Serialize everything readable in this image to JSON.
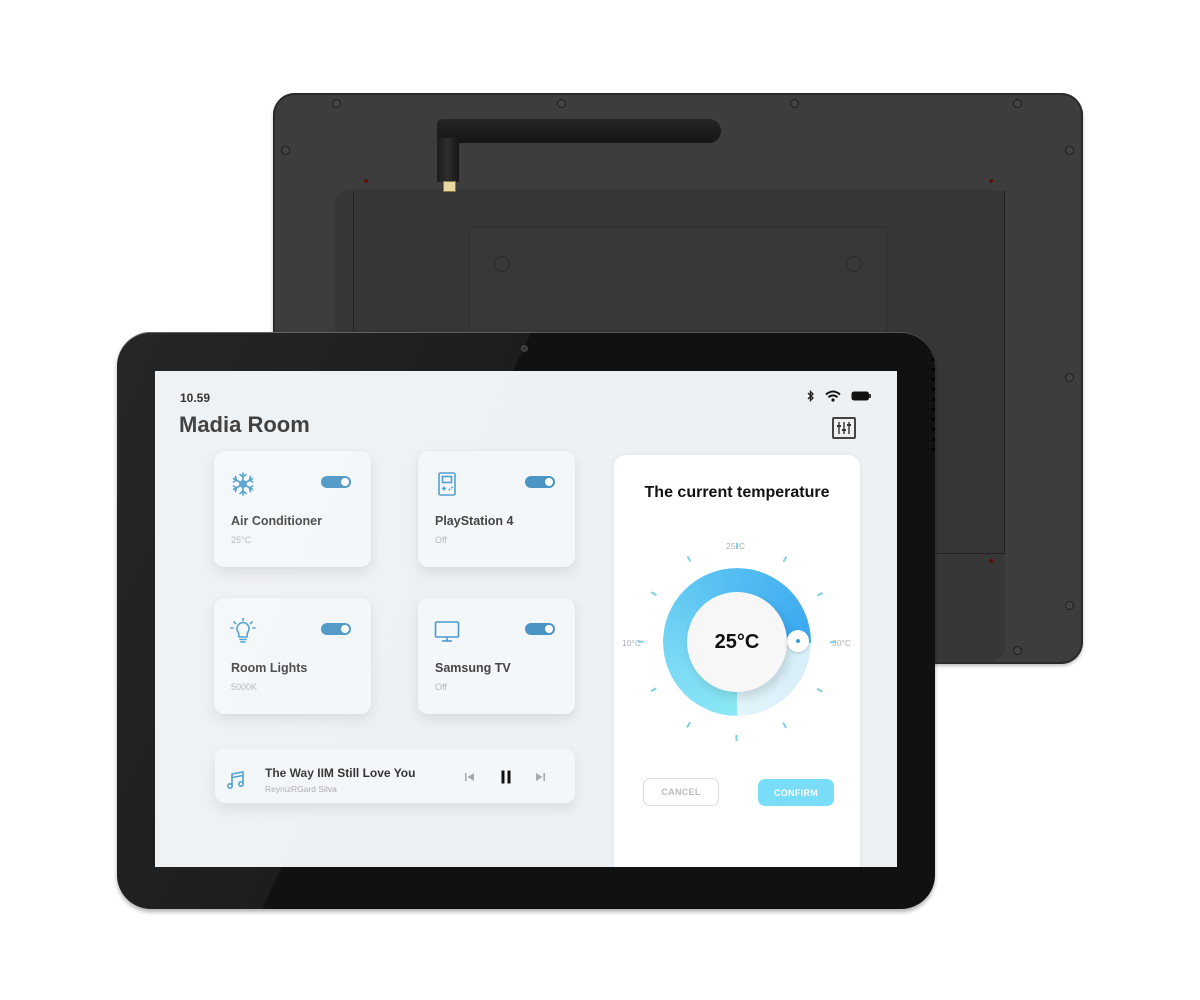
{
  "status_bar": {
    "time": "10.59",
    "icons": [
      "bluetooth-icon",
      "wifi-icon",
      "battery-icon"
    ]
  },
  "header": {
    "room_title": "Madia Room",
    "settings_icon": "equalizer-sliders-icon"
  },
  "devices": [
    {
      "name": "Air Conditioner",
      "status": "25°C",
      "icon": "snowflake-icon",
      "on": true
    },
    {
      "name": "PlayStation 4",
      "status": "Off",
      "icon": "gameboy-icon",
      "on": true
    },
    {
      "name": "Room Lights",
      "status": "5000K",
      "icon": "lightbulb-icon",
      "on": true
    },
    {
      "name": "Samsung TV",
      "status": "Off",
      "icon": "monitor-icon",
      "on": true
    }
  ],
  "player": {
    "song": "The Way IIM Still Love You",
    "artist": "ReynizRGard Silva",
    "state": "playing"
  },
  "thermostat": {
    "title": "The current temperature",
    "current": "25°C",
    "scale_labels": {
      "top": "25°C",
      "left": "10°C",
      "right": "30°C"
    },
    "cancel_label": "CANCEL",
    "confirm_label": "CONFIRM"
  },
  "colors": {
    "accent": "#4a95c4",
    "dial_start": "#8be8f5",
    "dial_end": "#3aa7f0",
    "confirm": "#79ddf7"
  }
}
